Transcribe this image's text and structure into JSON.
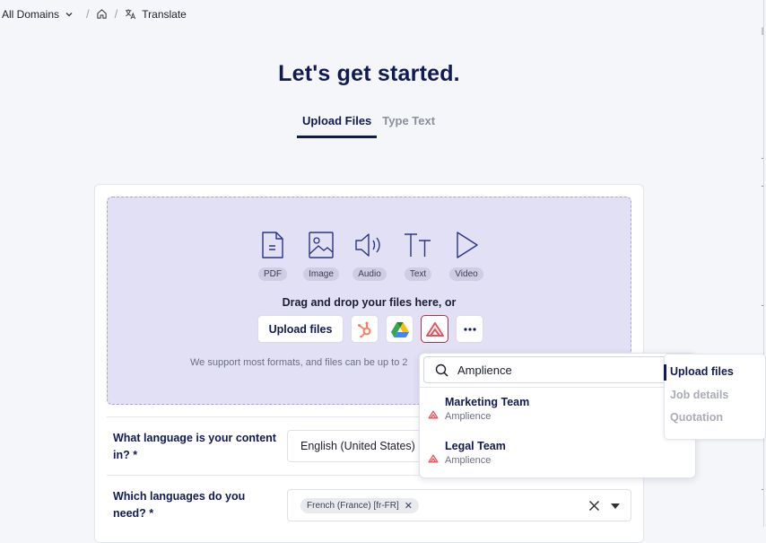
{
  "breadcrumb": {
    "domain": "All Domains",
    "current": "Translate"
  },
  "title": "Let's get started.",
  "tabs": [
    {
      "label": "Upload Files"
    },
    {
      "label": "Type Text"
    }
  ],
  "file_types": [
    {
      "label": "PDF",
      "icon": "pdf-icon"
    },
    {
      "label": "Image",
      "icon": "image-icon"
    },
    {
      "label": "Audio",
      "icon": "audio-icon"
    },
    {
      "label": "Text",
      "icon": "text-icon"
    },
    {
      "label": "Video",
      "icon": "video-icon"
    }
  ],
  "drop_text": "Drag and drop your files here, or",
  "upload_button": "Upload files",
  "integrations": [
    "hubspot-icon",
    "google-drive-icon",
    "amplience-icon",
    "more-icon"
  ],
  "support_text": "We support most formats, and files can be up to 2",
  "search": {
    "value": "Amplience"
  },
  "results": [
    {
      "name": "Marketing Team",
      "source": "Amplience"
    },
    {
      "name": "Legal Team",
      "source": "Amplience"
    }
  ],
  "questions": {
    "source_language": {
      "label": "What language is your content in? *",
      "value": "English (United States)"
    },
    "target_languages": {
      "label": "Which languages do you need? *",
      "tags": [
        "French (France) [fr-FR]"
      ]
    }
  },
  "steps": [
    {
      "label": "Upload files",
      "active": true
    },
    {
      "label": "Job details",
      "active": false
    },
    {
      "label": "Quotation",
      "active": false
    }
  ],
  "colors": {
    "primary": "#101a53",
    "dropzone": "#e2e0f5",
    "hubspot": "#ff7a59",
    "amplience": "#e8505b"
  }
}
